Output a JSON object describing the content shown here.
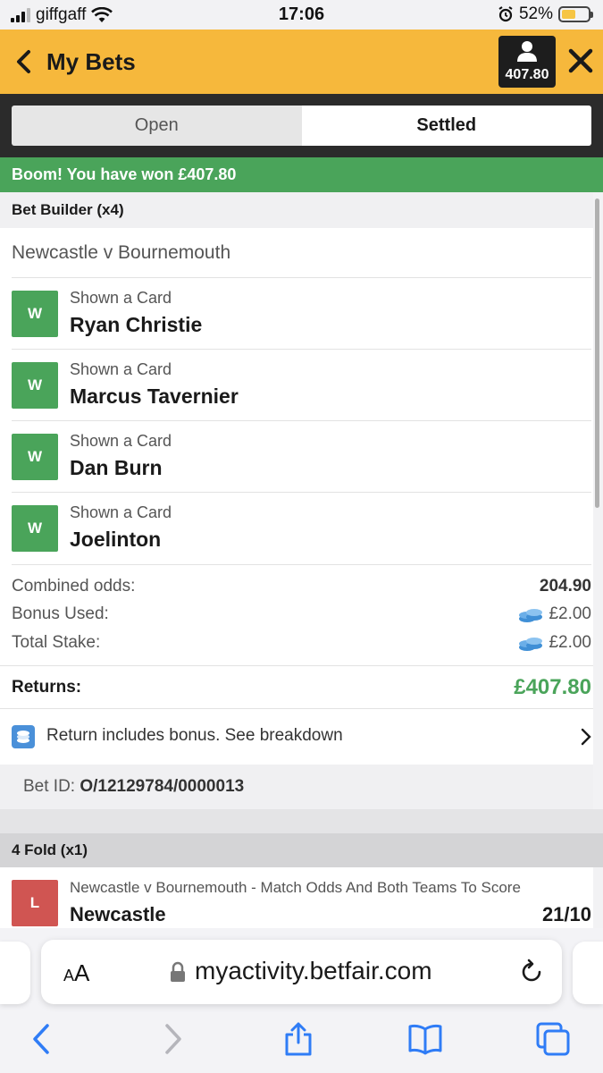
{
  "status": {
    "carrier": "giffgaff",
    "time": "17:06",
    "battery": "52%"
  },
  "header": {
    "title": "My Bets",
    "balance": "407.80"
  },
  "tabs": [
    {
      "label": "Open"
    },
    {
      "label": "Settled"
    }
  ],
  "banner": "Boom! You have won £407.80",
  "bet": {
    "type": "Bet Builder (x4)",
    "event": "Newcastle v Bournemouth",
    "legs": [
      {
        "result": "W",
        "market": "Shown a Card",
        "selection": "Ryan Christie"
      },
      {
        "result": "W",
        "market": "Shown a Card",
        "selection": "Marcus Tavernier"
      },
      {
        "result": "W",
        "market": "Shown a Card",
        "selection": "Dan Burn"
      },
      {
        "result": "W",
        "market": "Shown a Card",
        "selection": "Joelinton"
      }
    ],
    "combined_odds_label": "Combined odds:",
    "combined_odds": "204.90",
    "bonus_used_label": "Bonus Used:",
    "bonus_used": "£2.00",
    "total_stake_label": "Total Stake:",
    "total_stake": "£2.00",
    "returns_label": "Returns:",
    "returns": "£407.80",
    "bonus_note": "Return includes bonus. See breakdown",
    "bet_id_label": "Bet ID:",
    "bet_id": "O/12129784/0000013"
  },
  "fold": {
    "type": "4 Fold (x1)",
    "result": "L",
    "market": "Newcastle v Bournemouth - Match Odds And Both Teams To Score",
    "selection": "Newcastle",
    "odds": "21/10"
  },
  "browser": {
    "aa_small": "A",
    "aa_large": "A",
    "url": "myactivity.betfair.com"
  },
  "colors": {
    "brand": "#f6b83c",
    "win": "#4aa45a",
    "lose": "#d05552",
    "ios_blue": "#2f7cf6"
  }
}
